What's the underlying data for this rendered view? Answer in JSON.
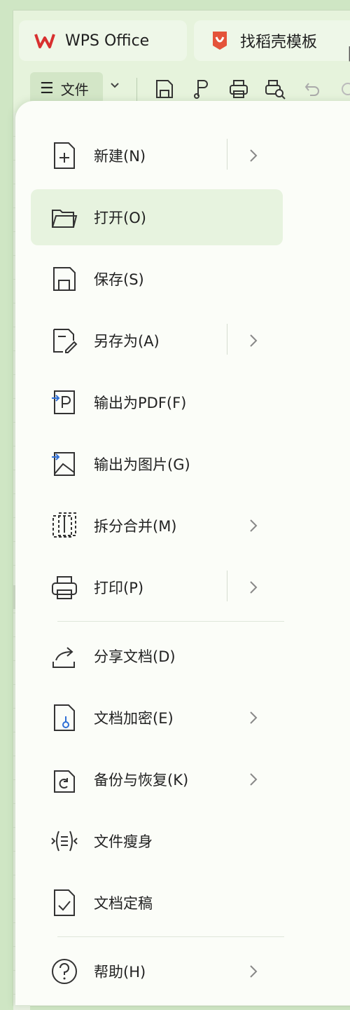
{
  "tabs": [
    {
      "label": "WPS Office",
      "icon": "wps-logo-icon",
      "color": "#d8302f"
    },
    {
      "label": "找稻壳模板",
      "icon": "docer-logo-icon",
      "color": "#e4533a"
    }
  ],
  "toolbar": {
    "file_label": "文件",
    "icons": [
      "save-icon",
      "export-pdf-icon",
      "print-icon",
      "print-preview-icon",
      "undo-icon",
      "redo-icon"
    ]
  },
  "menu": {
    "items": [
      {
        "label": "新建(N)",
        "icon": "new-document-icon",
        "submenu": true,
        "split": true
      },
      {
        "label": "打开(O)",
        "icon": "open-folder-icon",
        "submenu": false,
        "hover": true
      },
      {
        "label": "保存(S)",
        "icon": "save-icon",
        "submenu": false
      },
      {
        "label": "另存为(A)",
        "icon": "save-as-icon",
        "submenu": true,
        "split": true
      },
      {
        "label": "输出为PDF(F)",
        "icon": "export-pdf-icon",
        "submenu": false
      },
      {
        "label": "输出为图片(G)",
        "icon": "export-image-icon",
        "submenu": false
      },
      {
        "label": "拆分合并(M)",
        "icon": "split-merge-icon",
        "submenu": true
      },
      {
        "label": "打印(P)",
        "icon": "print-icon",
        "submenu": true,
        "split": true
      },
      {
        "label": "分享文档(D)",
        "icon": "share-icon",
        "submenu": false
      },
      {
        "label": "文档加密(E)",
        "icon": "encrypt-icon",
        "submenu": true
      },
      {
        "label": "备份与恢复(K)",
        "icon": "backup-restore-icon",
        "submenu": true
      },
      {
        "label": "文件瘦身",
        "icon": "slim-file-icon",
        "submenu": false
      },
      {
        "label": "文档定稿",
        "icon": "finalize-icon",
        "submenu": false
      },
      {
        "label": "帮助(H)",
        "icon": "help-icon",
        "submenu": true
      }
    ]
  },
  "colors": {
    "accent": "#d8302f",
    "hover": "#e7f3df",
    "background": "#cfe6c4"
  }
}
